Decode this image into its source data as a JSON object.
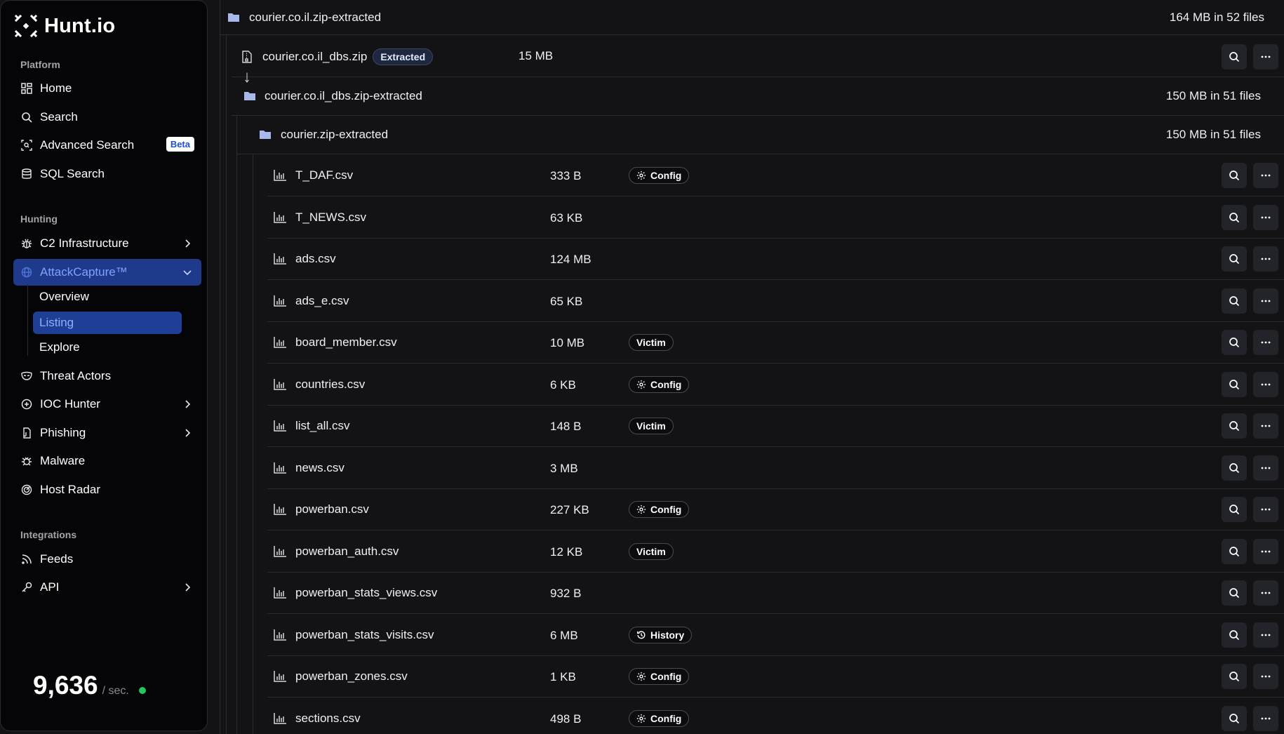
{
  "sidebar": {
    "brand": "Hunt.io",
    "sections": {
      "platform": "Platform",
      "hunting": "Hunting",
      "integrations": "Integrations"
    },
    "items": {
      "home": "Home",
      "search": "Search",
      "advanced_search": "Advanced Search",
      "beta": "Beta",
      "sql_search": "SQL Search",
      "c2": "C2 Infrastructure",
      "attackcapture": "AttackCapture™",
      "overview": "Overview",
      "listing": "Listing",
      "explore": "Explore",
      "threat_actors": "Threat Actors",
      "ioc_hunter": "IOC Hunter",
      "phishing": "Phishing",
      "malware": "Malware",
      "host_radar": "Host Radar",
      "feeds": "Feeds",
      "api": "API"
    },
    "counter": {
      "value": "9,636",
      "unit": "/ sec."
    },
    "colors": {
      "active_bg": "#1f3a8a",
      "status_dot": "#22c55e"
    }
  },
  "main": {
    "root_folder": {
      "name": "courier.co.il.zip-extracted",
      "summary": "164 MB in 52 files"
    },
    "zip_file": {
      "name": "courier.co.il_dbs.zip",
      "badge": "Extracted",
      "size": "15 MB"
    },
    "sub_folder": {
      "name": "courier.co.il_dbs.zip-extracted",
      "summary": "150 MB in 51 files"
    },
    "inner_folder": {
      "name": "courier.zip-extracted",
      "summary": "150 MB in 51 files"
    },
    "arrow": "↓",
    "files": [
      {
        "name": "T_DAF.csv",
        "size": "333 B",
        "tag": "Config",
        "tag_icon": "gear-icon"
      },
      {
        "name": "T_NEWS.csv",
        "size": "63 KB",
        "tag": "",
        "tag_icon": ""
      },
      {
        "name": "ads.csv",
        "size": "124 MB",
        "tag": "",
        "tag_icon": ""
      },
      {
        "name": "ads_e.csv",
        "size": "65 KB",
        "tag": "",
        "tag_icon": ""
      },
      {
        "name": "board_member.csv",
        "size": "10 MB",
        "tag": "Victim",
        "tag_icon": ""
      },
      {
        "name": "countries.csv",
        "size": "6 KB",
        "tag": "Config",
        "tag_icon": "gear-icon"
      },
      {
        "name": "list_all.csv",
        "size": "148 B",
        "tag": "Victim",
        "tag_icon": ""
      },
      {
        "name": "news.csv",
        "size": "3 MB",
        "tag": "",
        "tag_icon": ""
      },
      {
        "name": "powerban.csv",
        "size": "227 KB",
        "tag": "Config",
        "tag_icon": "gear-icon"
      },
      {
        "name": "powerban_auth.csv",
        "size": "12 KB",
        "tag": "Victim",
        "tag_icon": ""
      },
      {
        "name": "powerban_stats_views.csv",
        "size": "932 B",
        "tag": "",
        "tag_icon": ""
      },
      {
        "name": "powerban_stats_visits.csv",
        "size": "6 MB",
        "tag": "History",
        "tag_icon": "history-icon"
      },
      {
        "name": "powerban_zones.csv",
        "size": "1 KB",
        "tag": "Config",
        "tag_icon": "gear-icon"
      },
      {
        "name": "sections.csv",
        "size": "498 B",
        "tag": "Config",
        "tag_icon": "gear-icon"
      }
    ]
  }
}
